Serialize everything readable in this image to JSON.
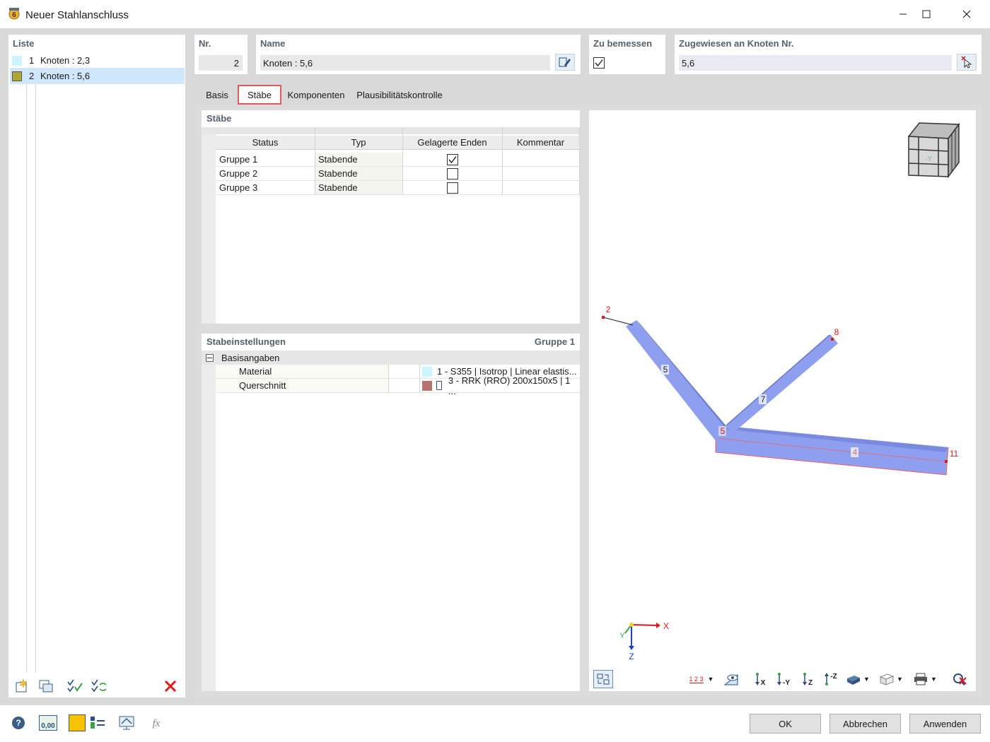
{
  "window": {
    "title": "Neuer Stahlanschluss",
    "minimize_icon": "minimize-icon",
    "maximize_icon": "maximize-icon",
    "close_icon": "close-icon"
  },
  "list": {
    "header": "Liste",
    "items": [
      {
        "num": "1",
        "label": "Knoten : 2,3",
        "color": "#ccf5ff",
        "selected": false
      },
      {
        "num": "2",
        "label": "Knoten : 5,6",
        "color": "#b0a832",
        "selected": true
      }
    ]
  },
  "fields": {
    "nr_label": "Nr.",
    "nr_value": "2",
    "name_label": "Name",
    "name_value": "Knoten : 5,6",
    "design_label": "Zu bemessen",
    "design_checked": true,
    "assigned_label": "Zugewiesen an Knoten Nr.",
    "assigned_value": "5,6"
  },
  "tabs": [
    {
      "label": "Basis",
      "active": false
    },
    {
      "label": "Stäbe",
      "active": true
    },
    {
      "label": "Komponenten",
      "active": false
    },
    {
      "label": "Plausibilitätskontrolle",
      "active": false
    }
  ],
  "members": {
    "title": "Stäbe",
    "columns": [
      "Status",
      "Typ",
      "Gelagerte Enden",
      "Kommentar"
    ],
    "rows": [
      {
        "status": "Gruppe 1",
        "typ": "Stabende",
        "supported": true,
        "comment": ""
      },
      {
        "status": "Gruppe 2",
        "typ": "Stabende",
        "supported": false,
        "comment": ""
      },
      {
        "status": "Gruppe 3",
        "typ": "Stabende",
        "supported": false,
        "comment": ""
      }
    ]
  },
  "settings": {
    "title": "Stabeinstellungen",
    "group": "Gruppe 1",
    "section": "Basisangaben",
    "material_label": "Material",
    "material_value": "1 - S355 | Isotrop | Linear elastis...",
    "material_color": "#ccf5ff",
    "section_label": "Querschnitt",
    "section_value": "3 - RRK (RRO) 200x150x5 | 1 ...",
    "section_color": "#b87070"
  },
  "view": {
    "nodes": [
      "2",
      "8",
      "5",
      "11"
    ],
    "members": [
      "5",
      "7",
      "4"
    ],
    "cube_label": "-Y",
    "axes": {
      "x": "X",
      "y": "Y",
      "z": "Z"
    },
    "toolbar": [
      "numbering-icon",
      "view-eye-icon",
      "axis-x-icon",
      "axis-neg-y-icon",
      "axis-z-icon",
      "axis-neg-z-icon",
      "render-mode-icon",
      "transparency-icon",
      "print-icon",
      "reset-view-icon"
    ],
    "toolbar_labels": {
      "numbers": "1 2 3",
      "x": "X",
      "neg_y": "-Y",
      "z": "Z",
      "neg_z": "-Z"
    }
  },
  "buttons": {
    "ok": "OK",
    "cancel": "Abbrechen",
    "apply": "Anwenden",
    "units_label": "0,00"
  }
}
